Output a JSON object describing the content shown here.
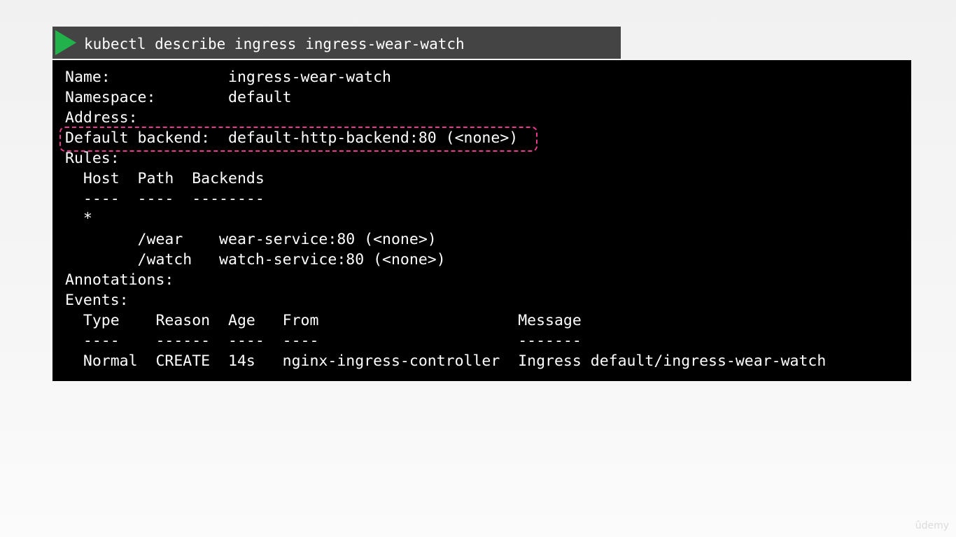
{
  "command_bar": {
    "command": "kubectl describe ingress ingress-wear-watch",
    "play_icon_color": "#21b24b"
  },
  "terminal": {
    "lines": [
      "Name:             ingress-wear-watch",
      "Namespace:        default",
      "Address:",
      "Default backend:  default-http-backend:80 (<none>)",
      "Rules:",
      "  Host  Path  Backends",
      "  ----  ----  --------",
      "  *",
      "        /wear    wear-service:80 (<none>)",
      "        /watch   watch-service:80 (<none>)",
      "Annotations:",
      "Events:",
      "  Type    Reason  Age   From                      Message",
      "  ----    ------  ----  ----                      -------",
      "  Normal  CREATE  14s   nginx-ingress-controller  Ingress default/ingress-wear-watch"
    ],
    "highlight_color": "#e83a8e"
  },
  "watermark": "ûdemy"
}
